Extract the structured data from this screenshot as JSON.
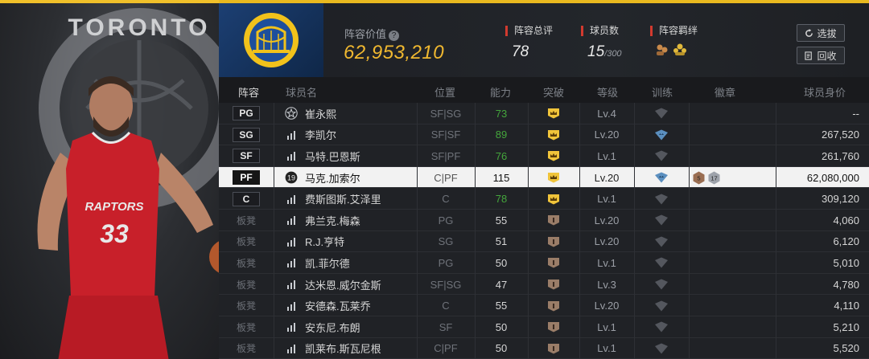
{
  "header": {
    "value_label": "阵容价值",
    "value_help_icon": "?",
    "value": "62,953,210",
    "rating_label": "阵容总评",
    "rating": "78",
    "count_label": "球员数",
    "count": "15",
    "count_max": "/300",
    "bond_label": "阵容羁绊",
    "select_button": "选拔",
    "recycle_button": "回收",
    "accent_color": "#f0b830",
    "stat_accent_color": "#d23a2f"
  },
  "columns": [
    "阵容",
    "球员名",
    "位置",
    "能力",
    "突破",
    "等级",
    "训练",
    "徽章",
    "球员身价"
  ],
  "rows": [
    {
      "pos": "PG",
      "starter": true,
      "icon": "star-icon",
      "name": "崔永熙",
      "position": "SF|SG",
      "ability": "73",
      "ability_color": "green",
      "breakthrough": "gold-crown",
      "level": "Lv.4",
      "training": "empty",
      "badges": [],
      "price": "--"
    },
    {
      "pos": "SG",
      "starter": true,
      "icon": "bars-icon",
      "name": "李凯尔",
      "position": "SF|SF",
      "ability": "89",
      "ability_color": "green",
      "breakthrough": "gold-crown",
      "level": "Lv.20",
      "training": "blue",
      "badges": [],
      "price": "267,520"
    },
    {
      "pos": "SF",
      "starter": true,
      "icon": "bars-icon",
      "name": "马特.巴恩斯",
      "position": "SF|PF",
      "ability": "76",
      "ability_color": "green",
      "breakthrough": "gold-crown",
      "level": "Lv.1",
      "training": "empty",
      "badges": [],
      "price": "261,760"
    },
    {
      "pos": "PF",
      "starter": true,
      "selected": true,
      "icon": "jersey-icon",
      "icon_num": "19",
      "name": "马克.加索尔",
      "position": "C|PF",
      "ability": "115",
      "ability_color": "normal",
      "breakthrough": "gold-crown",
      "level": "Lv.20",
      "training": "blue",
      "badges": [
        "5",
        "17"
      ],
      "price": "62,080,000"
    },
    {
      "pos": "C",
      "starter": true,
      "icon": "bars-icon",
      "name": "费斯图斯.艾泽里",
      "position": "C",
      "ability": "78",
      "ability_color": "green",
      "breakthrough": "gold-crown",
      "level": "Lv.1",
      "training": "empty",
      "badges": [],
      "price": "309,120"
    },
    {
      "pos": "板凳",
      "starter": false,
      "icon": "bars-icon",
      "name": "弗兰克.梅森",
      "position": "PG",
      "ability": "55",
      "ability_color": "normal",
      "breakthrough": "bronze",
      "level": "Lv.20",
      "training": "empty",
      "badges": [],
      "price": "4,060"
    },
    {
      "pos": "板凳",
      "starter": false,
      "icon": "bars-icon",
      "name": "R.J.亨特",
      "position": "SG",
      "ability": "51",
      "ability_color": "normal",
      "breakthrough": "bronze",
      "level": "Lv.20",
      "training": "empty",
      "badges": [],
      "price": "6,120"
    },
    {
      "pos": "板凳",
      "starter": false,
      "icon": "bars-icon",
      "name": "凯.菲尔德",
      "position": "PG",
      "ability": "50",
      "ability_color": "normal",
      "breakthrough": "bronze",
      "level": "Lv.1",
      "training": "empty",
      "badges": [],
      "price": "5,010"
    },
    {
      "pos": "板凳",
      "starter": false,
      "icon": "bars-icon",
      "name": "达米恩.威尔金斯",
      "position": "SF|SG",
      "ability": "47",
      "ability_color": "normal",
      "breakthrough": "bronze",
      "level": "Lv.3",
      "training": "empty",
      "badges": [],
      "price": "4,780"
    },
    {
      "pos": "板凳",
      "starter": false,
      "icon": "bars-icon",
      "name": "安德森.瓦莱乔",
      "position": "C",
      "ability": "55",
      "ability_color": "normal",
      "breakthrough": "bronze",
      "level": "Lv.20",
      "training": "empty",
      "badges": [],
      "price": "4,110"
    },
    {
      "pos": "板凳",
      "starter": false,
      "icon": "bars-icon",
      "name": "安东尼.布朗",
      "position": "SF",
      "ability": "50",
      "ability_color": "normal",
      "breakthrough": "bronze",
      "level": "Lv.1",
      "training": "empty",
      "badges": [],
      "price": "5,210"
    },
    {
      "pos": "板凳",
      "starter": false,
      "icon": "bars-icon",
      "name": "凯莱布.斯瓦尼根",
      "position": "C|PF",
      "ability": "50",
      "ability_color": "normal",
      "breakthrough": "bronze",
      "level": "Lv.1",
      "training": "empty",
      "badges": [],
      "price": "5,520"
    }
  ],
  "hero": {
    "team_wordmark": "TORONTO",
    "jersey_team": "RAPTORS",
    "jersey_number": "33"
  }
}
